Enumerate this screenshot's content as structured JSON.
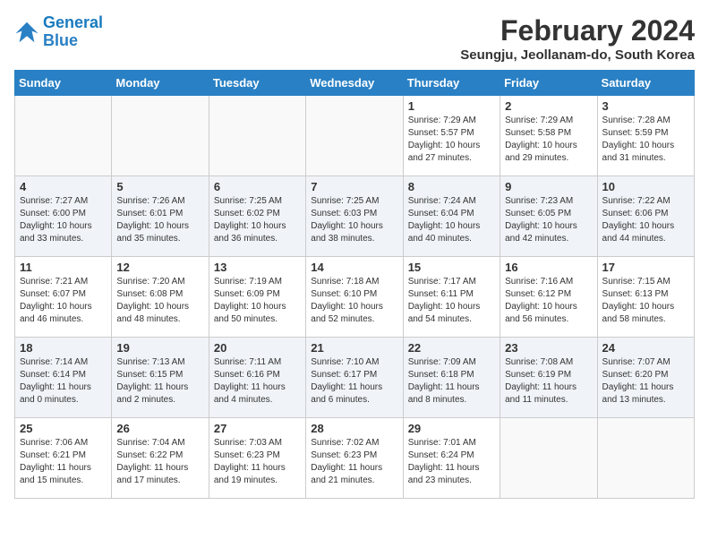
{
  "logo": {
    "line1": "General",
    "line2": "Blue"
  },
  "title": "February 2024",
  "location": "Seungju, Jeollanam-do, South Korea",
  "weekdays": [
    "Sunday",
    "Monday",
    "Tuesday",
    "Wednesday",
    "Thursday",
    "Friday",
    "Saturday"
  ],
  "weeks": [
    [
      {
        "day": "",
        "detail": ""
      },
      {
        "day": "",
        "detail": ""
      },
      {
        "day": "",
        "detail": ""
      },
      {
        "day": "",
        "detail": ""
      },
      {
        "day": "1",
        "detail": "Sunrise: 7:29 AM\nSunset: 5:57 PM\nDaylight: 10 hours\nand 27 minutes."
      },
      {
        "day": "2",
        "detail": "Sunrise: 7:29 AM\nSunset: 5:58 PM\nDaylight: 10 hours\nand 29 minutes."
      },
      {
        "day": "3",
        "detail": "Sunrise: 7:28 AM\nSunset: 5:59 PM\nDaylight: 10 hours\nand 31 minutes."
      }
    ],
    [
      {
        "day": "4",
        "detail": "Sunrise: 7:27 AM\nSunset: 6:00 PM\nDaylight: 10 hours\nand 33 minutes."
      },
      {
        "day": "5",
        "detail": "Sunrise: 7:26 AM\nSunset: 6:01 PM\nDaylight: 10 hours\nand 35 minutes."
      },
      {
        "day": "6",
        "detail": "Sunrise: 7:25 AM\nSunset: 6:02 PM\nDaylight: 10 hours\nand 36 minutes."
      },
      {
        "day": "7",
        "detail": "Sunrise: 7:25 AM\nSunset: 6:03 PM\nDaylight: 10 hours\nand 38 minutes."
      },
      {
        "day": "8",
        "detail": "Sunrise: 7:24 AM\nSunset: 6:04 PM\nDaylight: 10 hours\nand 40 minutes."
      },
      {
        "day": "9",
        "detail": "Sunrise: 7:23 AM\nSunset: 6:05 PM\nDaylight: 10 hours\nand 42 minutes."
      },
      {
        "day": "10",
        "detail": "Sunrise: 7:22 AM\nSunset: 6:06 PM\nDaylight: 10 hours\nand 44 minutes."
      }
    ],
    [
      {
        "day": "11",
        "detail": "Sunrise: 7:21 AM\nSunset: 6:07 PM\nDaylight: 10 hours\nand 46 minutes."
      },
      {
        "day": "12",
        "detail": "Sunrise: 7:20 AM\nSunset: 6:08 PM\nDaylight: 10 hours\nand 48 minutes."
      },
      {
        "day": "13",
        "detail": "Sunrise: 7:19 AM\nSunset: 6:09 PM\nDaylight: 10 hours\nand 50 minutes."
      },
      {
        "day": "14",
        "detail": "Sunrise: 7:18 AM\nSunset: 6:10 PM\nDaylight: 10 hours\nand 52 minutes."
      },
      {
        "day": "15",
        "detail": "Sunrise: 7:17 AM\nSunset: 6:11 PM\nDaylight: 10 hours\nand 54 minutes."
      },
      {
        "day": "16",
        "detail": "Sunrise: 7:16 AM\nSunset: 6:12 PM\nDaylight: 10 hours\nand 56 minutes."
      },
      {
        "day": "17",
        "detail": "Sunrise: 7:15 AM\nSunset: 6:13 PM\nDaylight: 10 hours\nand 58 minutes."
      }
    ],
    [
      {
        "day": "18",
        "detail": "Sunrise: 7:14 AM\nSunset: 6:14 PM\nDaylight: 11 hours\nand 0 minutes."
      },
      {
        "day": "19",
        "detail": "Sunrise: 7:13 AM\nSunset: 6:15 PM\nDaylight: 11 hours\nand 2 minutes."
      },
      {
        "day": "20",
        "detail": "Sunrise: 7:11 AM\nSunset: 6:16 PM\nDaylight: 11 hours\nand 4 minutes."
      },
      {
        "day": "21",
        "detail": "Sunrise: 7:10 AM\nSunset: 6:17 PM\nDaylight: 11 hours\nand 6 minutes."
      },
      {
        "day": "22",
        "detail": "Sunrise: 7:09 AM\nSunset: 6:18 PM\nDaylight: 11 hours\nand 8 minutes."
      },
      {
        "day": "23",
        "detail": "Sunrise: 7:08 AM\nSunset: 6:19 PM\nDaylight: 11 hours\nand 11 minutes."
      },
      {
        "day": "24",
        "detail": "Sunrise: 7:07 AM\nSunset: 6:20 PM\nDaylight: 11 hours\nand 13 minutes."
      }
    ],
    [
      {
        "day": "25",
        "detail": "Sunrise: 7:06 AM\nSunset: 6:21 PM\nDaylight: 11 hours\nand 15 minutes."
      },
      {
        "day": "26",
        "detail": "Sunrise: 7:04 AM\nSunset: 6:22 PM\nDaylight: 11 hours\nand 17 minutes."
      },
      {
        "day": "27",
        "detail": "Sunrise: 7:03 AM\nSunset: 6:23 PM\nDaylight: 11 hours\nand 19 minutes."
      },
      {
        "day": "28",
        "detail": "Sunrise: 7:02 AM\nSunset: 6:23 PM\nDaylight: 11 hours\nand 21 minutes."
      },
      {
        "day": "29",
        "detail": "Sunrise: 7:01 AM\nSunset: 6:24 PM\nDaylight: 11 hours\nand 23 minutes."
      },
      {
        "day": "",
        "detail": ""
      },
      {
        "day": "",
        "detail": ""
      }
    ]
  ]
}
